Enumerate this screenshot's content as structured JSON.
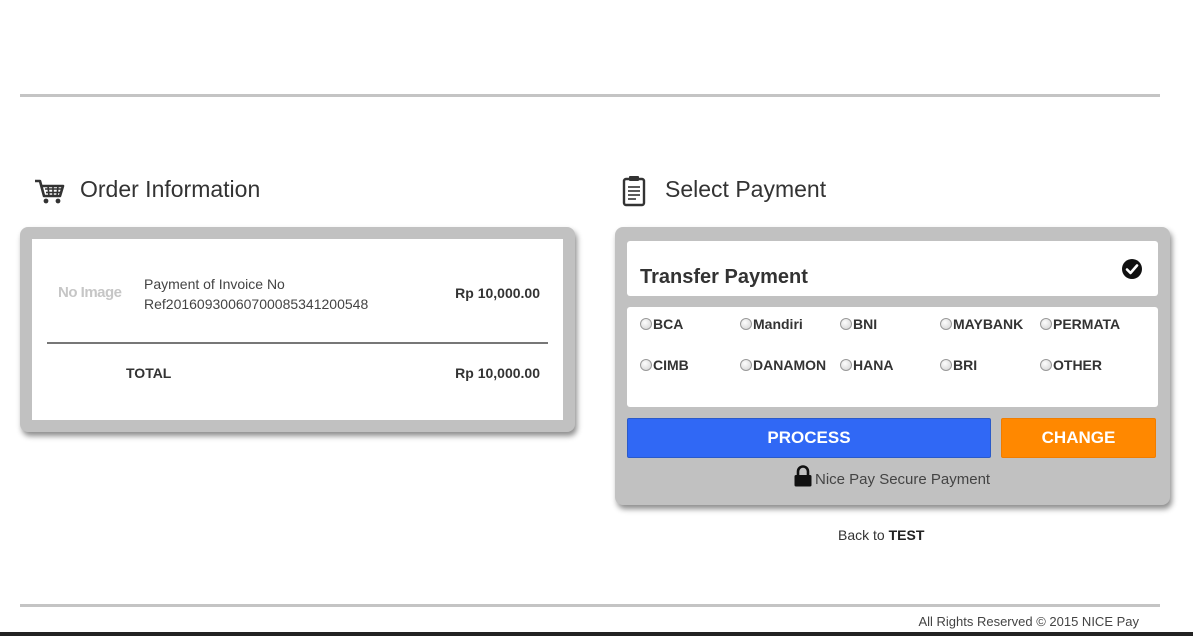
{
  "order": {
    "title": "Order Information",
    "no_image": "No Image",
    "item_desc_line1": "Payment of Invoice No",
    "item_desc_line2": "Ref2016093006070008534120054​8",
    "item_price": "Rp 10,000.00",
    "total_label": "TOTAL",
    "total_price": "Rp 10,000.00"
  },
  "payment": {
    "title": "Select Payment",
    "method_title": "Transfer Payment",
    "banks_row1": [
      "BCA",
      "Mandiri",
      "BNI",
      "MAYBANK",
      "PERMATA"
    ],
    "banks_row2": [
      "CIMB",
      "DANAMON",
      "HANA",
      "BRI",
      "OTHER"
    ],
    "process_label": "PROCESS",
    "change_label": "CHANGE",
    "secure_text": "Nice Pay Secure Payment",
    "colors": {
      "process": "#3068f5",
      "change": "#ff8800",
      "panel": "#c1c1c1"
    }
  },
  "back": {
    "prefix": "Back to",
    "target": "TEST"
  },
  "footer": {
    "text": "All Rights Reserved © 2015 NICE Pay"
  },
  "icons": {
    "cart": "shopping-cart-icon",
    "receipt": "receipt-icon",
    "check": "check-circle-icon",
    "lock": "lock-icon"
  }
}
